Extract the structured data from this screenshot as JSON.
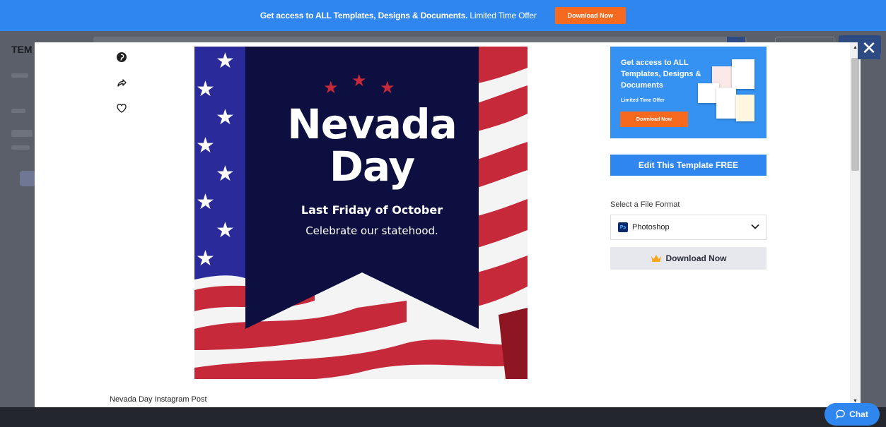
{
  "banner": {
    "text_bold": "Get access to ALL Templates, Designs & Documents.",
    "text_light": " Limited Time Offer",
    "button_label": "Download Now"
  },
  "background_page": {
    "logo_fragment": "TEM"
  },
  "modal": {
    "close_label": "✕",
    "social": {
      "pinterest": "pinterest-icon",
      "share": "share-icon",
      "favorite": "heart-icon"
    },
    "poster": {
      "title_line1": "Nevada",
      "title_line2": "Day",
      "subtitle": "Last Friday of October",
      "tagline": "Celebrate our statehood."
    },
    "caption": "Nevada Day Instagram Post",
    "promo": {
      "title": "Get access to ALL Templates, Designs & Documents",
      "subtitle": "Limited Time Offer",
      "button_label": "Download Now"
    },
    "edit_button_label": "Edit This Template FREE",
    "format": {
      "label": "Select a File Format",
      "selected": "Photoshop",
      "icon_text": "Ps"
    },
    "download_button_label": "Download Now"
  },
  "chat": {
    "label": "Chat"
  },
  "colors": {
    "brand_blue": "#2f86ef",
    "offer_orange": "#f56a1f",
    "poster_navy": "#0d0f40",
    "flag_red": "#c5293a",
    "flag_blue": "#2a2a9a"
  }
}
